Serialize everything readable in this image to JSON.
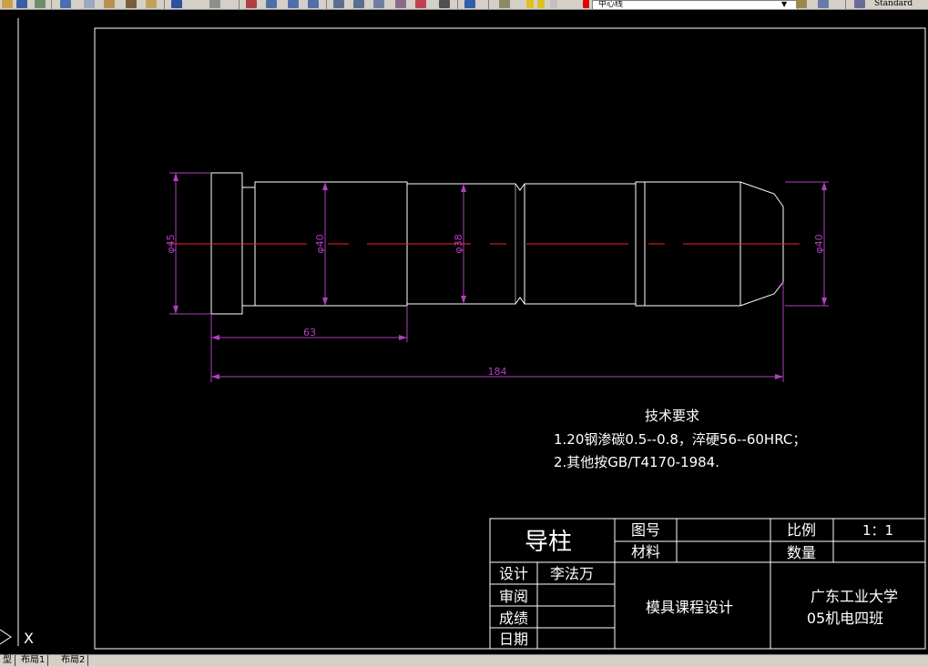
{
  "toolbar": {
    "layer_name": "中心线",
    "text_style": "Standard"
  },
  "drawing": {
    "part_dims": {
      "d45": "φ45",
      "d40_left": "φ40",
      "d38": "φ38",
      "d40_right": "φ40",
      "len_63": "63",
      "len_184": "184"
    },
    "tech_title": "技术要求",
    "tech_line1": "1.20钢渗碳0.5--0.8，淬硬56--60HRC；",
    "tech_line2": "2.其他按GB/T4170-1984."
  },
  "title_block": {
    "part_name": "导柱",
    "drawing_no_label": "图号",
    "material_label": "材料",
    "scale_label": "比例",
    "scale_value": "1：1",
    "qty_label": "数量",
    "design_label": "设计",
    "designer": "李法万",
    "review_label": "审阅",
    "grade_label": "成绩",
    "date_label": "日期",
    "course": "模具课程设计",
    "school": "广东工业大学",
    "class": "05机电四班"
  },
  "ucs": {
    "x_label": "X"
  },
  "status": {
    "tabs": [
      "型",
      "布局1",
      "布局2"
    ]
  }
}
